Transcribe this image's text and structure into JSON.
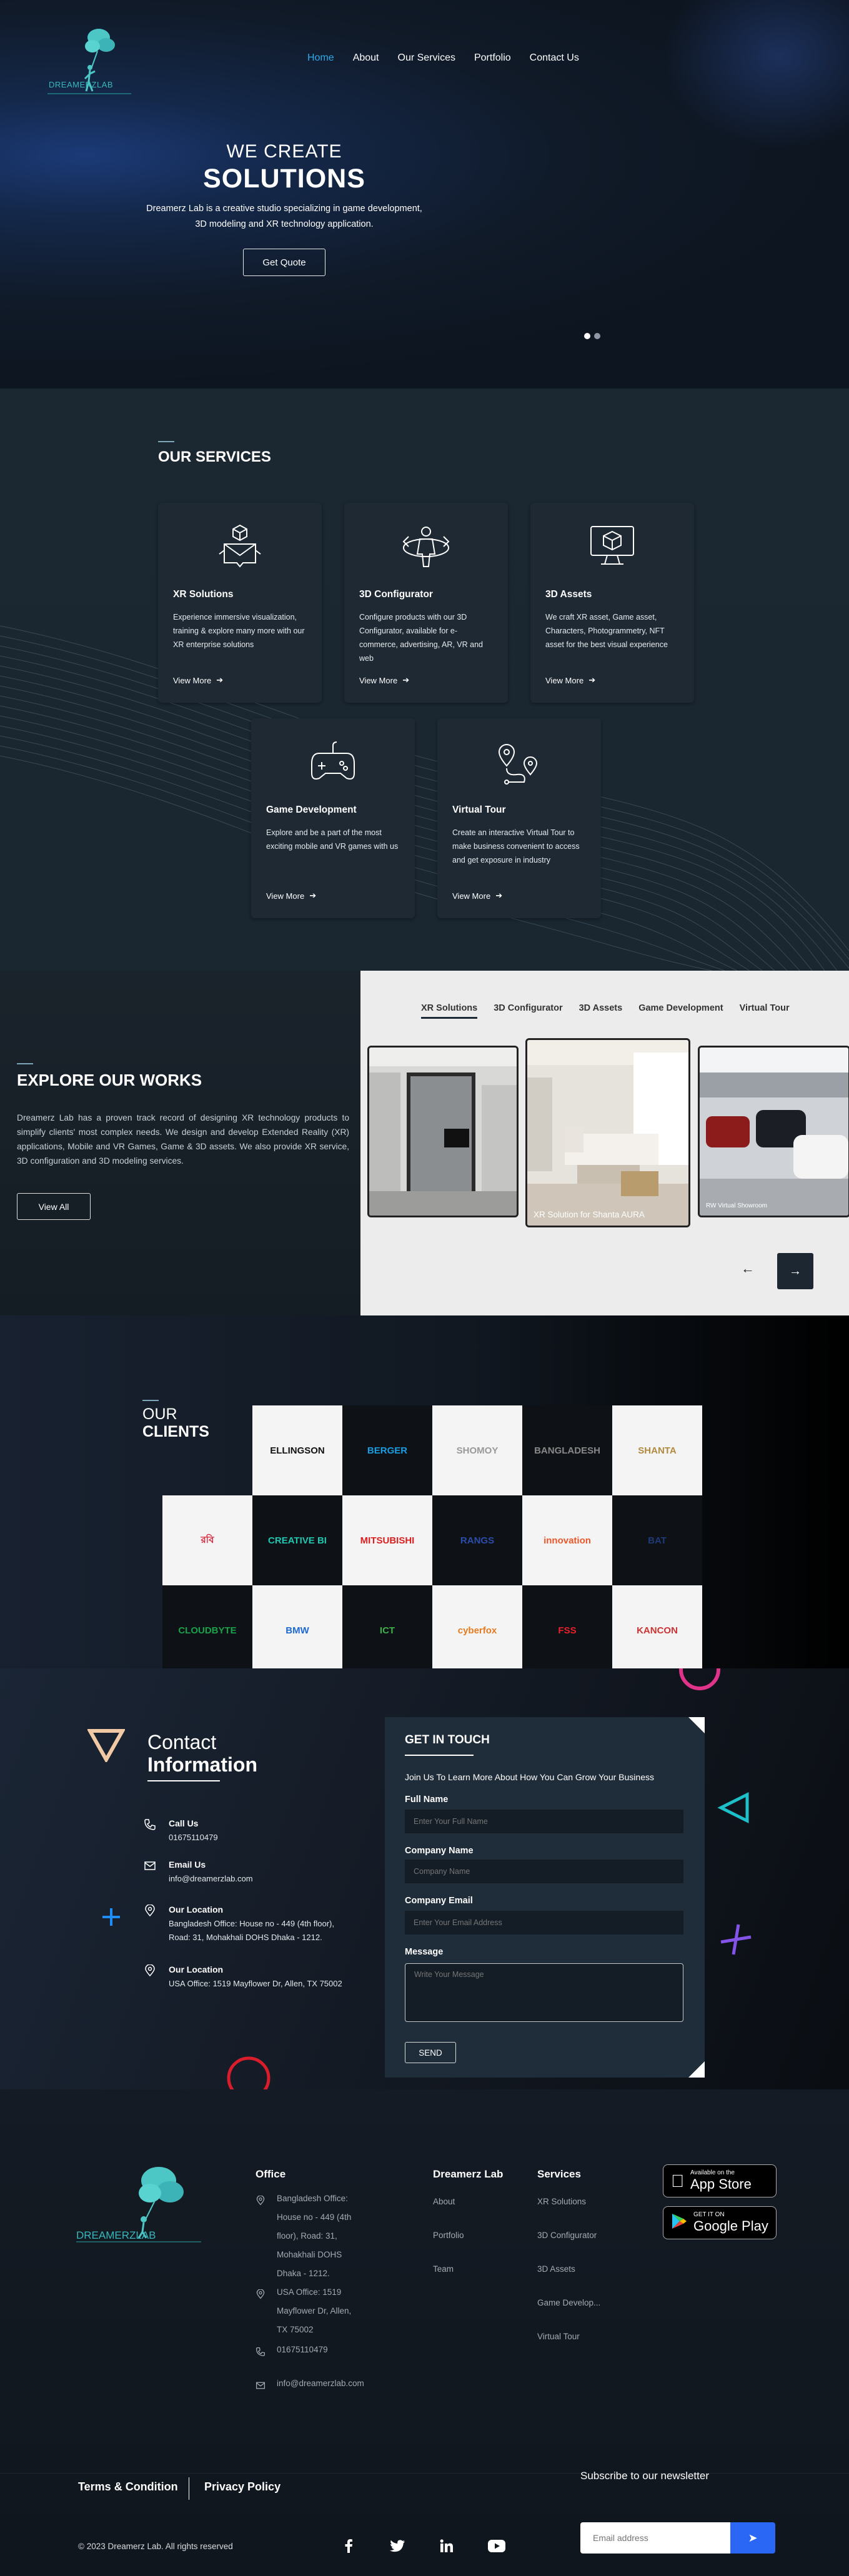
{
  "nav": {
    "items": [
      "Home",
      "About",
      "Our Services",
      "Portfolio",
      "Contact Us"
    ],
    "logo_text": "DREAMERZLAB"
  },
  "hero": {
    "subtitle": "WE CREATE",
    "title": "SOLUTIONS",
    "description": "Dreamerz Lab is a creative studio specializing in game development, 3D modeling and XR technology application.",
    "cta": "Get Quote"
  },
  "services": {
    "title": "OUR SERVICES",
    "view_more": "View More",
    "items": [
      {
        "title": "XR Solutions",
        "desc": "Experience immersive visualization, training & explore many more with our XR enterprise solutions",
        "icon": "vr-cube-icon"
      },
      {
        "title": "3D Configurator",
        "desc": "Configure products with our 3D Configurator, available for e-commerce, advertising, AR, VR and web",
        "icon": "3d-person-icon"
      },
      {
        "title": "3D Assets",
        "desc": "We craft XR asset, Game asset, Characters, Photogrammetry, NFT asset for the best visual experience",
        "icon": "monitor-cube-icon"
      },
      {
        "title": "Game Development",
        "desc": "Explore and be a part of the most exciting mobile and VR games with us",
        "icon": "gamepad-icon"
      },
      {
        "title": "Virtual Tour",
        "desc": "Create an interactive Virtual Tour to make business convenient to access and get exposure in industry",
        "icon": "route-pin-icon"
      }
    ]
  },
  "works": {
    "title": "EXPLORE OUR WORKS",
    "desc": "Dreamerz Lab has a proven track record of designing XR technology products to simplify clients' most complex needs. We design and develop Extended Reality (XR) applications, Mobile and VR Games, Game & 3D assets. We also provide XR service, 3D configuration and 3D modeling services.",
    "cta": "View All",
    "tabs": [
      "XR Solutions",
      "3D Configurator",
      "3D Assets",
      "Game Development",
      "Virtual Tour"
    ],
    "cards": [
      {
        "caption": ""
      },
      {
        "caption": "XR Solution for Shanta AURA"
      },
      {
        "caption": "RW Virtual Showroom"
      }
    ]
  },
  "clients": {
    "title1": "OUR",
    "title2": "CLIENTS",
    "logos": [
      {
        "name": "ELLINGSON",
        "bg": "light",
        "color": "#111111"
      },
      {
        "name": "BERGER",
        "bg": "dark",
        "color": "#1b9de2"
      },
      {
        "name": "SHOMOY",
        "bg": "light",
        "color": "#999999"
      },
      {
        "name": "BANGLADESH",
        "bg": "dark",
        "color": "#888888"
      },
      {
        "name": "SHANTA",
        "bg": "light",
        "color": "#b08a3e"
      },
      {
        "name": "রবি",
        "bg": "light",
        "color": "#d7263d"
      },
      {
        "name": "CREATIVE BI",
        "bg": "dark",
        "color": "#1fc7b0"
      },
      {
        "name": "MITSUBISHI",
        "bg": "light",
        "color": "#d81e1e"
      },
      {
        "name": "RANGS",
        "bg": "dark",
        "color": "#2b4ca8"
      },
      {
        "name": "innovation",
        "bg": "light",
        "color": "#e8572a"
      },
      {
        "name": "BAT",
        "bg": "dark",
        "color": "#1e3a78"
      },
      {
        "name": "CLOUDBYTE",
        "bg": "dark",
        "color": "#1aa14a"
      },
      {
        "name": "BMW",
        "bg": "light",
        "color": "#1c69d4"
      },
      {
        "name": "ICT",
        "bg": "dark",
        "color": "#3db24a"
      },
      {
        "name": "cyberfox",
        "bg": "light",
        "color": "#e37b21"
      },
      {
        "name": "FSS",
        "bg": "dark",
        "color": "#e8212c"
      },
      {
        "name": "KANCON",
        "bg": "light",
        "color": "#cc3333"
      }
    ]
  },
  "contact": {
    "title1": "Contact",
    "title2": "Information",
    "items": [
      {
        "label": "Call Us",
        "value": "01675110479",
        "icon": "phone-icon"
      },
      {
        "label": "Email Us",
        "value": "info@dreamerzlab.com",
        "icon": "mail-icon"
      },
      {
        "label": "Our Location",
        "value": "Bangladesh Office: House no - 449 (4th floor), Road: 31, Mohakhali DOHS Dhaka - 1212.",
        "icon": "location-icon"
      },
      {
        "label": "Our Location",
        "value": "USA Office: 1519 Mayflower Dr, Allen, TX 75002",
        "icon": "location-icon"
      }
    ],
    "form": {
      "title": "GET IN TOUCH",
      "lead": "Join Us To Learn More About How You Can Grow Your Business",
      "name_label": "Full Name",
      "name_placeholder": "Enter Your Full Name",
      "company_label": "Company Name",
      "company_placeholder": "Company Name",
      "email_label": "Company Email",
      "email_placeholder": "Enter Your Email Address",
      "message_label": "Message",
      "message_placeholder": "Write Your Message",
      "send": "SEND"
    }
  },
  "footer": {
    "office_title": "Office",
    "office_bd": "Bangladesh Office: House no - 449 (4th floor), Road: 31, Mohakhali DOHS Dhaka - 1212.",
    "office_usa": "USA Office: 1519 Mayflower Dr, Allen, TX 75002",
    "phone": "01675110479",
    "email": "info@dreamerzlab.com",
    "company_title": "Dreamerz Lab",
    "company_links": [
      "About",
      "Portfolio",
      "Team"
    ],
    "services_title": "Services",
    "services_links": [
      "XR Solutions",
      "3D Configurator",
      "3D Assets",
      "Game Develop...",
      "Virtual Tour"
    ],
    "appstore_small": "Available on the",
    "appstore_big": "App Store",
    "play_small": "GET IT ON",
    "play_big": "Google Play",
    "terms": "Terms & Condition",
    "privacy": "Privacy Policy",
    "copyright": "© 2023 Dreamerz Lab. All rights reserved",
    "subscribe_title": "Subscribe to our newsletter",
    "subscribe_placeholder": "Email address",
    "social": [
      "facebook-icon",
      "twitter-icon",
      "linkedin-icon",
      "youtube-icon"
    ]
  }
}
